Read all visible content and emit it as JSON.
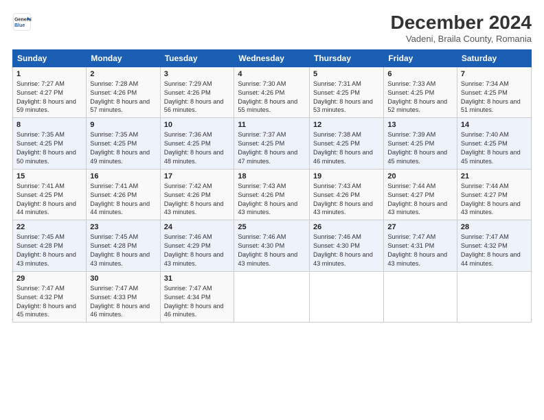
{
  "logo": {
    "line1": "General",
    "line2": "Blue"
  },
  "title": "December 2024",
  "subtitle": "Vadeni, Braila County, Romania",
  "days_header": [
    "Sunday",
    "Monday",
    "Tuesday",
    "Wednesday",
    "Thursday",
    "Friday",
    "Saturday"
  ],
  "weeks": [
    [
      {
        "day": "1",
        "sunrise": "Sunrise: 7:27 AM",
        "sunset": "Sunset: 4:27 PM",
        "daylight": "Daylight: 8 hours and 59 minutes."
      },
      {
        "day": "2",
        "sunrise": "Sunrise: 7:28 AM",
        "sunset": "Sunset: 4:26 PM",
        "daylight": "Daylight: 8 hours and 57 minutes."
      },
      {
        "day": "3",
        "sunrise": "Sunrise: 7:29 AM",
        "sunset": "Sunset: 4:26 PM",
        "daylight": "Daylight: 8 hours and 56 minutes."
      },
      {
        "day": "4",
        "sunrise": "Sunrise: 7:30 AM",
        "sunset": "Sunset: 4:26 PM",
        "daylight": "Daylight: 8 hours and 55 minutes."
      },
      {
        "day": "5",
        "sunrise": "Sunrise: 7:31 AM",
        "sunset": "Sunset: 4:25 PM",
        "daylight": "Daylight: 8 hours and 53 minutes."
      },
      {
        "day": "6",
        "sunrise": "Sunrise: 7:33 AM",
        "sunset": "Sunset: 4:25 PM",
        "daylight": "Daylight: 8 hours and 52 minutes."
      },
      {
        "day": "7",
        "sunrise": "Sunrise: 7:34 AM",
        "sunset": "Sunset: 4:25 PM",
        "daylight": "Daylight: 8 hours and 51 minutes."
      }
    ],
    [
      {
        "day": "8",
        "sunrise": "Sunrise: 7:35 AM",
        "sunset": "Sunset: 4:25 PM",
        "daylight": "Daylight: 8 hours and 50 minutes."
      },
      {
        "day": "9",
        "sunrise": "Sunrise: 7:35 AM",
        "sunset": "Sunset: 4:25 PM",
        "daylight": "Daylight: 8 hours and 49 minutes."
      },
      {
        "day": "10",
        "sunrise": "Sunrise: 7:36 AM",
        "sunset": "Sunset: 4:25 PM",
        "daylight": "Daylight: 8 hours and 48 minutes."
      },
      {
        "day": "11",
        "sunrise": "Sunrise: 7:37 AM",
        "sunset": "Sunset: 4:25 PM",
        "daylight": "Daylight: 8 hours and 47 minutes."
      },
      {
        "day": "12",
        "sunrise": "Sunrise: 7:38 AM",
        "sunset": "Sunset: 4:25 PM",
        "daylight": "Daylight: 8 hours and 46 minutes."
      },
      {
        "day": "13",
        "sunrise": "Sunrise: 7:39 AM",
        "sunset": "Sunset: 4:25 PM",
        "daylight": "Daylight: 8 hours and 45 minutes."
      },
      {
        "day": "14",
        "sunrise": "Sunrise: 7:40 AM",
        "sunset": "Sunset: 4:25 PM",
        "daylight": "Daylight: 8 hours and 45 minutes."
      }
    ],
    [
      {
        "day": "15",
        "sunrise": "Sunrise: 7:41 AM",
        "sunset": "Sunset: 4:25 PM",
        "daylight": "Daylight: 8 hours and 44 minutes."
      },
      {
        "day": "16",
        "sunrise": "Sunrise: 7:41 AM",
        "sunset": "Sunset: 4:26 PM",
        "daylight": "Daylight: 8 hours and 44 minutes."
      },
      {
        "day": "17",
        "sunrise": "Sunrise: 7:42 AM",
        "sunset": "Sunset: 4:26 PM",
        "daylight": "Daylight: 8 hours and 43 minutes."
      },
      {
        "day": "18",
        "sunrise": "Sunrise: 7:43 AM",
        "sunset": "Sunset: 4:26 PM",
        "daylight": "Daylight: 8 hours and 43 minutes."
      },
      {
        "day": "19",
        "sunrise": "Sunrise: 7:43 AM",
        "sunset": "Sunset: 4:26 PM",
        "daylight": "Daylight: 8 hours and 43 minutes."
      },
      {
        "day": "20",
        "sunrise": "Sunrise: 7:44 AM",
        "sunset": "Sunset: 4:27 PM",
        "daylight": "Daylight: 8 hours and 43 minutes."
      },
      {
        "day": "21",
        "sunrise": "Sunrise: 7:44 AM",
        "sunset": "Sunset: 4:27 PM",
        "daylight": "Daylight: 8 hours and 43 minutes."
      }
    ],
    [
      {
        "day": "22",
        "sunrise": "Sunrise: 7:45 AM",
        "sunset": "Sunset: 4:28 PM",
        "daylight": "Daylight: 8 hours and 43 minutes."
      },
      {
        "day": "23",
        "sunrise": "Sunrise: 7:45 AM",
        "sunset": "Sunset: 4:28 PM",
        "daylight": "Daylight: 8 hours and 43 minutes."
      },
      {
        "day": "24",
        "sunrise": "Sunrise: 7:46 AM",
        "sunset": "Sunset: 4:29 PM",
        "daylight": "Daylight: 8 hours and 43 minutes."
      },
      {
        "day": "25",
        "sunrise": "Sunrise: 7:46 AM",
        "sunset": "Sunset: 4:30 PM",
        "daylight": "Daylight: 8 hours and 43 minutes."
      },
      {
        "day": "26",
        "sunrise": "Sunrise: 7:46 AM",
        "sunset": "Sunset: 4:30 PM",
        "daylight": "Daylight: 8 hours and 43 minutes."
      },
      {
        "day": "27",
        "sunrise": "Sunrise: 7:47 AM",
        "sunset": "Sunset: 4:31 PM",
        "daylight": "Daylight: 8 hours and 43 minutes."
      },
      {
        "day": "28",
        "sunrise": "Sunrise: 7:47 AM",
        "sunset": "Sunset: 4:32 PM",
        "daylight": "Daylight: 8 hours and 44 minutes."
      }
    ],
    [
      {
        "day": "29",
        "sunrise": "Sunrise: 7:47 AM",
        "sunset": "Sunset: 4:32 PM",
        "daylight": "Daylight: 8 hours and 45 minutes."
      },
      {
        "day": "30",
        "sunrise": "Sunrise: 7:47 AM",
        "sunset": "Sunset: 4:33 PM",
        "daylight": "Daylight: 8 hours and 46 minutes."
      },
      {
        "day": "31",
        "sunrise": "Sunrise: 7:47 AM",
        "sunset": "Sunset: 4:34 PM",
        "daylight": "Daylight: 8 hours and 46 minutes."
      },
      null,
      null,
      null,
      null
    ]
  ]
}
